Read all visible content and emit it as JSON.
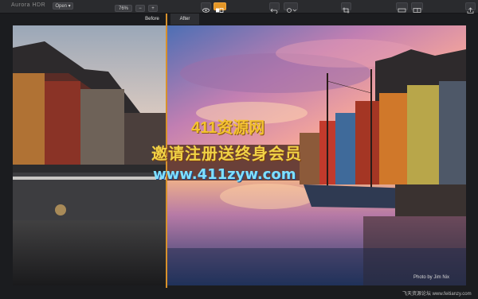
{
  "header": {
    "app_title": "Aurora HDR",
    "mode_select": "Open ▾",
    "zoom_value": "76%",
    "zoom_minus": "−",
    "zoom_plus": "+"
  },
  "tabs": {
    "before": "Before",
    "after": "After"
  },
  "photo": {
    "credit": "Photo by Jim Nix"
  },
  "watermarks": {
    "line1": "411资源网",
    "line2": "邀请注册送终身会员",
    "line3": "www.411zyw.com",
    "corner": "飞天资源论坛 www.feitianzy.com"
  },
  "colors": {
    "accent": "#e49626",
    "toolbar_bg": "#2a2b2e",
    "window_bg": "#1b1c1f"
  },
  "icons": [
    "eye-icon",
    "compare-icon",
    "undo-icon",
    "redo-icon",
    "crop-icon",
    "layers-icon",
    "panel-icon",
    "share-icon"
  ]
}
